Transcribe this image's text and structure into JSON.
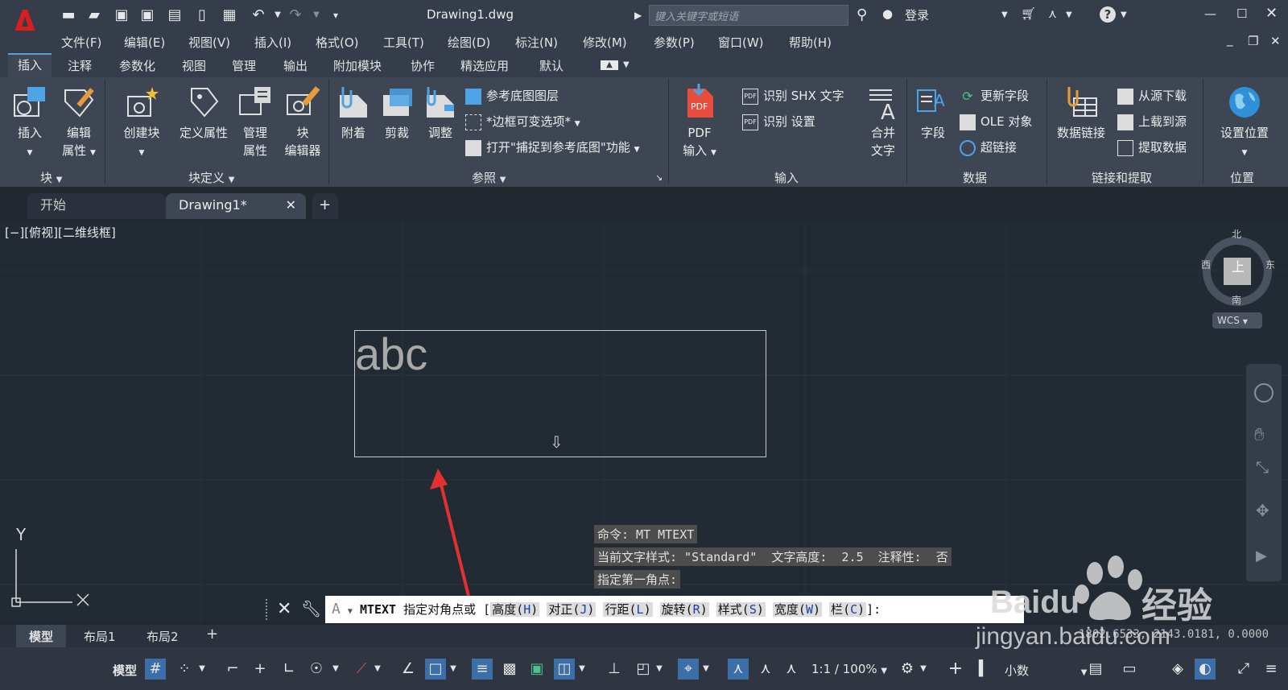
{
  "titlebar": {
    "doc_title": "Drawing1.dwg",
    "search_placeholder": "键入关键字或短语",
    "login_label": "登录"
  },
  "menu": [
    "文件(F)",
    "编辑(E)",
    "视图(V)",
    "插入(I)",
    "格式(O)",
    "工具(T)",
    "绘图(D)",
    "标注(N)",
    "修改(M)",
    "参数(P)",
    "窗口(W)",
    "帮助(H)"
  ],
  "ribbon_tabs": [
    "插入",
    "注释",
    "参数化",
    "视图",
    "管理",
    "输出",
    "附加模块",
    "协作",
    "精选应用",
    "默认"
  ],
  "ribbon": {
    "block": {
      "title": "块",
      "insert": "插入",
      "edit_attr_1": "编辑",
      "edit_attr_2": "属性"
    },
    "block_def": {
      "title": "块定义",
      "create": "创建块",
      "define_attr": "定义属性",
      "manage_1": "管理",
      "manage_2": "属性",
      "editor_1": "块",
      "editor_2": "编辑器"
    },
    "reference": {
      "title": "参照",
      "attach": "附着",
      "clip": "剪裁",
      "adjust": "调整",
      "underlay_layers": "参考底图图层",
      "frame_var": "*边框可变选项*",
      "snap_underlay": "打开\"捕捉到参考底图\"功能"
    },
    "import": {
      "title": "输入",
      "pdf_1": "PDF",
      "pdf_2": "输入",
      "shx": "识别 SHX 文字",
      "settings": "识别 设置",
      "merge_1": "合并",
      "merge_2": "文字"
    },
    "data": {
      "title": "数据",
      "field": "字段",
      "update_field": "更新字段",
      "ole": "OLE 对象",
      "hyperlink": "超链接"
    },
    "link": {
      "title": "链接和提取",
      "data_link": "数据链接",
      "download": "从源下载",
      "upload": "上载到源",
      "extract": "提取数据"
    },
    "location": {
      "title": "位置",
      "set": "设置位置"
    }
  },
  "doc_tabs": {
    "start": "开始",
    "drawing": "Drawing1*"
  },
  "canvas": {
    "view_label": "[−][俯视][二维线框]",
    "mtext": "abc",
    "viewcube": {
      "north": "北",
      "south": "南",
      "east": "东",
      "west": "西",
      "top": "上",
      "wcs": "WCS"
    },
    "ucs_y": "Y"
  },
  "command_history": [
    "命令: MT MTEXT",
    "当前文字样式: \"Standard\"  文字高度:  2.5  注释性:  否",
    "指定第一角点:"
  ],
  "command_line": {
    "prefix": "MTEXT",
    "prompt": "指定对角点或",
    "options": [
      {
        "label": "高度",
        "key": "H"
      },
      {
        "label": "对正",
        "key": "J"
      },
      {
        "label": "行距",
        "key": "L"
      },
      {
        "label": "旋转",
        "key": "R"
      },
      {
        "label": "样式",
        "key": "S"
      },
      {
        "label": "宽度",
        "key": "W"
      },
      {
        "label": "栏",
        "key": "C"
      }
    ]
  },
  "layout_tabs": [
    "模型",
    "布局1",
    "布局2"
  ],
  "status": {
    "model": "模型",
    "coords": "1802.6533, 2143.0181, 0.0000",
    "scale": "1:1 / 100%",
    "units": "小数"
  },
  "watermark": {
    "brand": "Baidu",
    "label": "经验",
    "url": "jingyan.baidu.com"
  }
}
